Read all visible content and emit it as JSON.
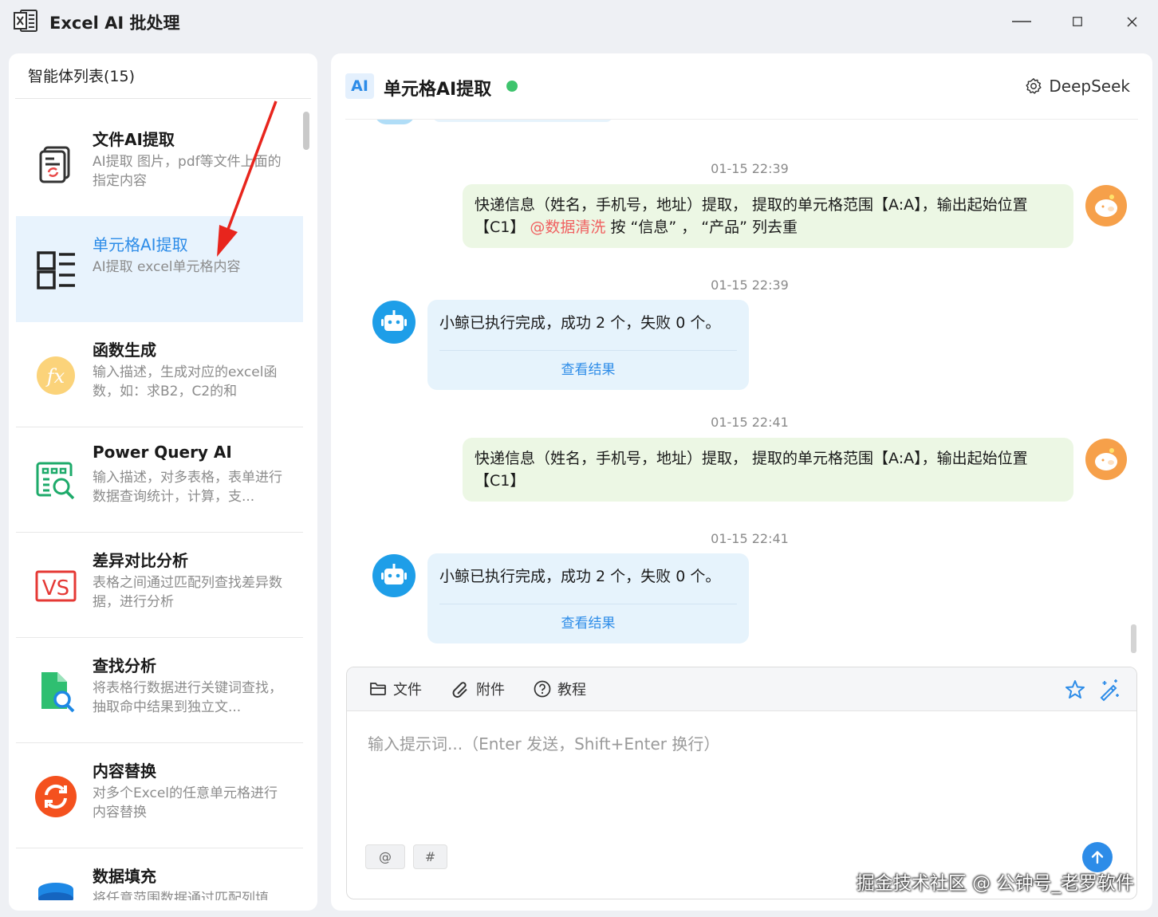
{
  "app": {
    "title": "Excel AI 批处理"
  },
  "sidebar": {
    "title": "智能体列表(15)",
    "items": [
      {
        "name": "文件AI提取",
        "desc": "AI提取 图片，pdf等文件上面的指定内容",
        "icon": "file-extract-icon"
      },
      {
        "name": "单元格AI提取",
        "desc": "AI提取 excel单元格内容",
        "icon": "grid-list-icon",
        "active": true
      },
      {
        "name": "函数生成",
        "desc": "输入描述，生成对应的excel函数，如：求B2，C2的和",
        "icon": "fx-icon"
      },
      {
        "name": "Power Query AI",
        "desc": "输入描述，对多表格，表单进行数据查询统计，计算，支...",
        "icon": "query-icon"
      },
      {
        "name": "差异对比分析",
        "desc": "表格之间通过匹配列查找差异数据，进行分析",
        "icon": "vs-icon"
      },
      {
        "name": "查找分析",
        "desc": "将表格行数据进行关键词查找，抽取命中结果到独立文...",
        "icon": "search-file-icon"
      },
      {
        "name": "内容替换",
        "desc": "对多个Excel的任意单元格进行内容替换",
        "icon": "replace-icon"
      },
      {
        "name": "数据填充",
        "desc": "将任意范围数据通过匹配列填",
        "icon": "database-icon"
      }
    ]
  },
  "chat": {
    "badge": "AI",
    "title": "单元格AI提取",
    "model": "DeepSeek",
    "messages": [
      {
        "time": "01-15 22:39",
        "role": "user",
        "text": "快递信息（姓名，手机号，地址）提取， 提取的单元格范围【A:A】，输出起始位置【C1】 ",
        "mention": "@数据清洗",
        "after": " 按 “信息” ，  “产品” 列去重"
      },
      {
        "time": "01-15 22:39",
        "role": "bot",
        "text": "小鲸已执行完成，成功 2 个，失败 0 个。",
        "link": "查看结果"
      },
      {
        "time": "01-15 22:41",
        "role": "user",
        "text": "快递信息（姓名，手机号，地址）提取， 提取的单元格范围【A:A】，输出起始位置【C1】"
      },
      {
        "time": "01-15 22:41",
        "role": "bot",
        "text": "小鲸已执行完成，成功 2 个，失败 0 个。",
        "link": "查看结果"
      }
    ]
  },
  "composer": {
    "file_label": "文件",
    "attach_label": "附件",
    "tutorial_label": "教程",
    "placeholder": "输入提示词...（Enter 发送，Shift+Enter 换行）",
    "at_label": "@",
    "hash_label": "#"
  },
  "watermark": "掘金技术社区 @ 公钟号_老罗软件",
  "colors": {
    "accent": "#2d8ce8",
    "online": "#3ec46d",
    "user_bubble": "#ecf7e4",
    "bot_bubble": "#e6f3fc",
    "mention": "#f06060"
  }
}
